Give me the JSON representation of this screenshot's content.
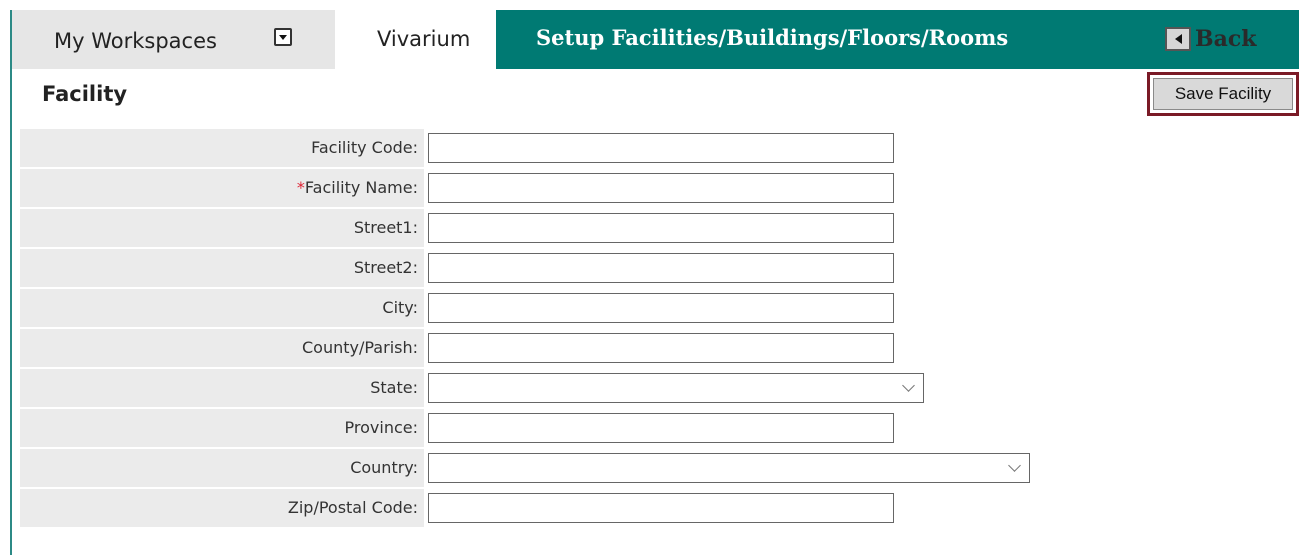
{
  "tabs": {
    "workspaces": "My Workspaces",
    "vivarium": "Vivarium",
    "setup": "Setup Facilities/Buildings/Floors/Rooms",
    "back": "Back"
  },
  "section": {
    "title": "Facility",
    "save_label": "Save Facility"
  },
  "form": {
    "required_mark": "*",
    "fields": [
      {
        "label": "Facility Code:",
        "value": ""
      },
      {
        "label": "Facility Name:",
        "value": ""
      },
      {
        "label": "Street1:",
        "value": ""
      },
      {
        "label": "Street2:",
        "value": ""
      },
      {
        "label": "City:",
        "value": ""
      },
      {
        "label": "County/Parish:",
        "value": ""
      },
      {
        "label": "State:",
        "value": ""
      },
      {
        "label": "Province:",
        "value": ""
      },
      {
        "label": "Country:",
        "value": ""
      },
      {
        "label": "Zip/Postal Code:",
        "value": ""
      }
    ]
  },
  "colors": {
    "tab_bar": "#007a73",
    "save_highlight": "#7a1a26",
    "required": "#dd2233"
  },
  "icons": {
    "workspaces_menu": "dropdown-icon",
    "back": "back-arrow-icon",
    "select": "chevron-down-icon"
  }
}
